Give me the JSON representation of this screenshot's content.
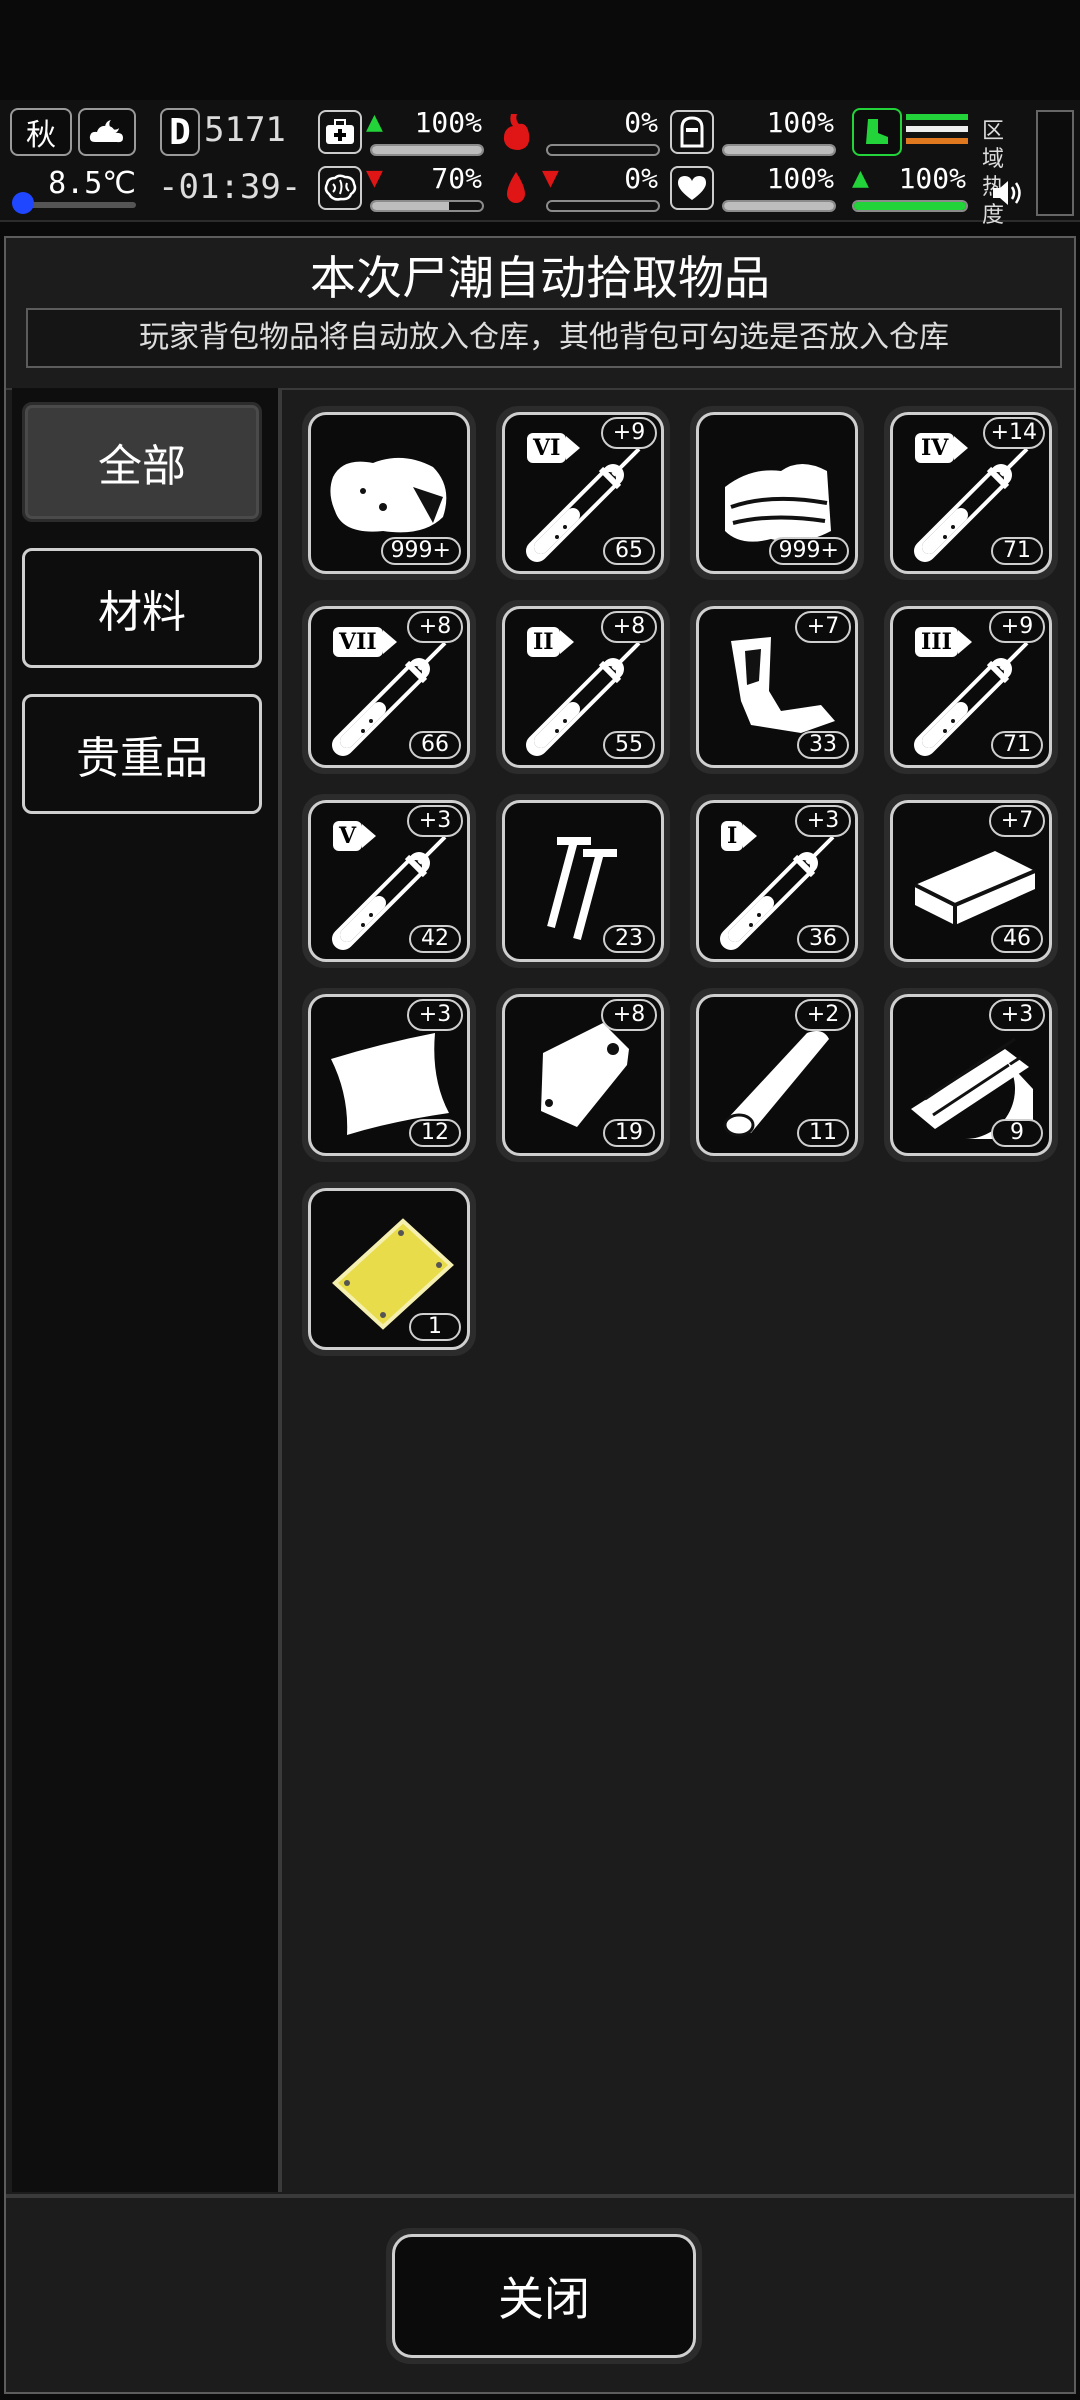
{
  "hud": {
    "season": "秋",
    "temperature": "8.5℃",
    "day_letter": "D",
    "day_number": "5171",
    "clock": "-01:39-",
    "stats_top": [
      {
        "name": "health",
        "icon": "medkit-icon",
        "trend": "up",
        "value": "100%",
        "fill": 1.0
      },
      {
        "name": "hunger",
        "icon": "stomach-icon",
        "trend": "none",
        "value": "0%",
        "fill": 0.0
      },
      {
        "name": "armor",
        "icon": "helmet-icon",
        "trend": "none",
        "value": "100%",
        "fill": 1.0
      }
    ],
    "stats_bottom": [
      {
        "name": "brain",
        "icon": "brain-icon",
        "trend": "down",
        "value": "70%",
        "fill": 0.7
      },
      {
        "name": "thirst",
        "icon": "blood-drop-icon",
        "trend": "down",
        "value": "0%",
        "fill": 0.0
      },
      {
        "name": "mood",
        "icon": "heart-icon",
        "trend": "none",
        "value": "100%",
        "fill": 1.0
      }
    ],
    "stamina": {
      "icon": "boot-icon",
      "trend": "up",
      "value": "100%",
      "fill": 1.0
    },
    "zone_label": "区域热度"
  },
  "dialog": {
    "title": "本次尸潮自动拾取物品",
    "subtitle": "玩家背包物品将自动放入仓库，其他背包可勾选是否放入仓库",
    "tabs": [
      "全部",
      "材料",
      "贵重品"
    ],
    "active_tab": "全部",
    "close_label": "关闭"
  },
  "items": [
    {
      "name": "cloth-bundle",
      "icon": "cloth-bundle-icon",
      "qty": "999+",
      "plus": "",
      "tier": ""
    },
    {
      "name": "syringe-vi",
      "icon": "syringe-icon",
      "qty": "65",
      "plus": "+9",
      "tier": "VI"
    },
    {
      "name": "towel",
      "icon": "towel-icon",
      "qty": "999+",
      "plus": "",
      "tier": ""
    },
    {
      "name": "syringe-iv",
      "icon": "syringe-icon",
      "qty": "71",
      "plus": "+14",
      "tier": "IV"
    },
    {
      "name": "syringe-vii",
      "icon": "syringe-icon",
      "qty": "66",
      "plus": "+8",
      "tier": "VII"
    },
    {
      "name": "syringe-ii",
      "icon": "syringe-icon",
      "qty": "55",
      "plus": "+8",
      "tier": "II"
    },
    {
      "name": "scrap-parts",
      "icon": "scrap-parts-icon",
      "qty": "33",
      "plus": "+7",
      "tier": ""
    },
    {
      "name": "syringe-iii",
      "icon": "syringe-icon",
      "qty": "71",
      "plus": "+9",
      "tier": "III"
    },
    {
      "name": "syringe-v",
      "icon": "syringe-icon",
      "qty": "42",
      "plus": "+3",
      "tier": "V"
    },
    {
      "name": "nails",
      "icon": "nails-icon",
      "qty": "23",
      "plus": "",
      "tier": ""
    },
    {
      "name": "syringe-i",
      "icon": "syringe-icon",
      "qty": "36",
      "plus": "+3",
      "tier": "I"
    },
    {
      "name": "wood-plank",
      "icon": "plank-icon",
      "qty": "46",
      "plus": "+7",
      "tier": ""
    },
    {
      "name": "tarp",
      "icon": "tarp-icon",
      "qty": "12",
      "plus": "+3",
      "tier": ""
    },
    {
      "name": "bag",
      "icon": "bag-icon",
      "qty": "19",
      "plus": "+8",
      "tier": ""
    },
    {
      "name": "log",
      "icon": "log-icon",
      "qty": "11",
      "plus": "+2",
      "tier": ""
    },
    {
      "name": "wood-scraps",
      "icon": "wood-scraps-icon",
      "qty": "9",
      "plus": "+3",
      "tier": ""
    },
    {
      "name": "gold-card",
      "icon": "gold-card-icon",
      "qty": "1",
      "plus": "",
      "tier": ""
    }
  ],
  "colors": {
    "accent_green": "#22d43a",
    "danger_red": "#e01515",
    "gold": "#e8dc4a",
    "cold_blue": "#1f47ff"
  }
}
